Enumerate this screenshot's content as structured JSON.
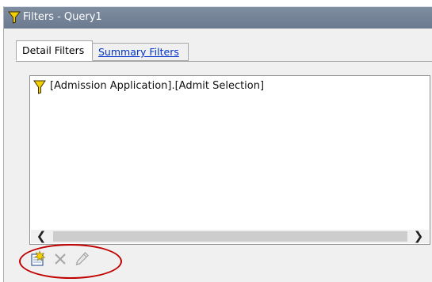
{
  "window": {
    "title": "Filters - Query1"
  },
  "tabs": [
    {
      "label": "Detail Filters",
      "active": true
    },
    {
      "label": "Summary Filters",
      "active": false
    }
  ],
  "filters": [
    {
      "icon": "filter-funnel-icon",
      "text": "[Admission Application].[Admit Selection]"
    }
  ],
  "toolbar": [
    {
      "icon": "new-filter-icon",
      "enabled": true
    },
    {
      "icon": "delete-x-icon",
      "enabled": false
    },
    {
      "icon": "edit-pencil-icon",
      "enabled": false
    }
  ],
  "scrollbar": {
    "left_arrow": "❮",
    "right_arrow": "❯"
  },
  "colors": {
    "titlebar": "#6b7a8f",
    "link": "#0033cc",
    "funnel": "#e8c300",
    "highlight": "#c00000"
  }
}
